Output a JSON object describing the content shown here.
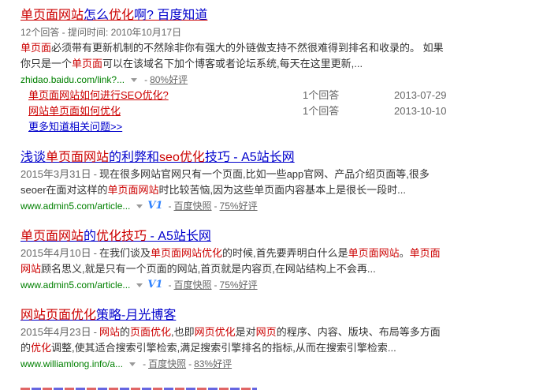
{
  "r1": {
    "title_em1": "单页面网站",
    "title_n1": "怎么",
    "title_em2": "优化",
    "title_n2": "啊? 百度知道",
    "meta": "12个回答 - 提问时间: 2010年10月17日",
    "abs_em1": "单页面",
    "abs_t1": "必须带有更新机制的不然除非你有强大的外链做支持不然很难得到排名和收录的。 如果你只是一个",
    "abs_em2": "单页面",
    "abs_t2": "可以在该域名下加个博客或者论坛系统,每天在这里更新,...",
    "url": "zhidao.baidu.com/link?...",
    "rating": "80%好评",
    "sub": [
      {
        "q": "单页面网站如何进行SEO优化?",
        "count": "1个回答",
        "date": "2013-07-29"
      },
      {
        "q": "网站单页面如何优化",
        "count": "1个回答",
        "date": "2013-10-10"
      }
    ],
    "more": "更多知道相关问题>>"
  },
  "r2": {
    "title_n1": "浅谈",
    "title_em1": "单页面网站",
    "title_n2": "的利弊和",
    "title_em2": "seo优化",
    "title_n3": "技巧 - A5站长网",
    "date": "2015年3月31日",
    "abs_t1": "现在很多网站官网只有一个页面,比如一些app官网、产品介绍页面等,很多seoer在面对这样的",
    "abs_em1": "单页面网站",
    "abs_t2": "时比较苦恼,因为这些单页面内容基本上是很长一段时...",
    "url": "www.admin5.com/article...",
    "v1": "V1",
    "snapshot": "百度快照",
    "rating": "75%好评"
  },
  "r3": {
    "title_em1": "单页面网站",
    "title_n1": "的",
    "title_em2": "优化技巧",
    "title_n2": " - A5站长网",
    "date": "2015年4月10日",
    "abs_t1": "在我们谈及",
    "abs_em1": "单页面网站优化",
    "abs_t2": "的时候,首先要弄明白什么是",
    "abs_em2": "单页面网站",
    "abs_t3": "。",
    "abs_em3": "单页面网站",
    "abs_t4": "顾名思义,就是只有一个页面的网站,首页就是内容页,在网站结构上不会再...",
    "url": "www.admin5.com/article...",
    "v1": "V1",
    "snapshot": "百度快照",
    "rating": "75%好评"
  },
  "r4": {
    "title_em1": "网站页面优化",
    "title_n1": "策略-月光博客",
    "date": "2015年4月23日",
    "abs_em1": "网站",
    "abs_t1": "的",
    "abs_em2": "页面优化",
    "abs_t2": ",也即",
    "abs_em3": "网页优化",
    "abs_t3": "是对",
    "abs_em4": "网页",
    "abs_t4": "的程序、内容、版块、布局等多方面的",
    "abs_em5": "优化",
    "abs_t5": "调整,使其适合搜索引擎检索,满足搜索引擎排名的指标,从而在搜索引擎检索...",
    "url": "www.williamlong.info/a...",
    "snapshot": "百度快照",
    "rating": "83%好评"
  }
}
